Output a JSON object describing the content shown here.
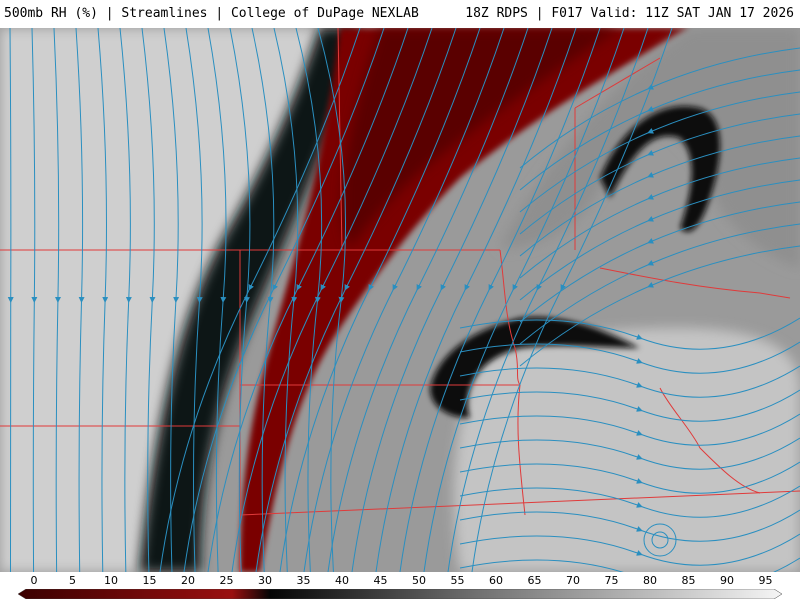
{
  "header": {
    "left": "500mb RH (%) | Streamlines | College of DuPage NEXLAB",
    "right": "18Z RDPS | F017 Valid: 11Z SAT JAN 17 2026"
  },
  "colorbar": {
    "ticks": [
      "0",
      "5",
      "10",
      "15",
      "20",
      "25",
      "30",
      "35",
      "40",
      "45",
      "50",
      "55",
      "60",
      "65",
      "70",
      "75",
      "80",
      "85",
      "90",
      "95"
    ],
    "colors": {
      "dry_dark": "#4a0000",
      "dry": "#8b0a0a",
      "transition": "#0a0a0a",
      "moist_mid": "#8a8a8a",
      "moist_high": "#e6e6e6"
    }
  },
  "map": {
    "streamline_color": "#2a8fc0",
    "border_color": "#e03a3a"
  }
}
